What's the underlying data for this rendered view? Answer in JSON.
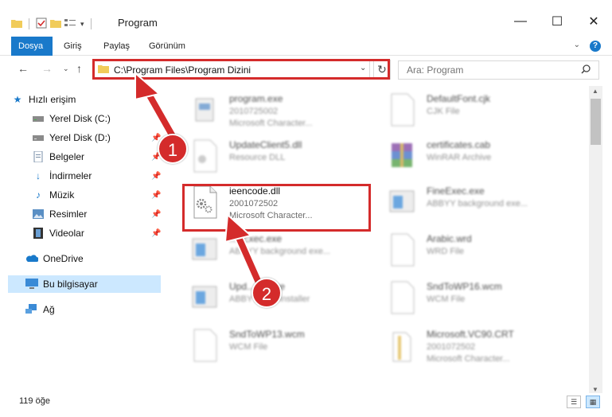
{
  "window": {
    "title": "Program",
    "minimize": "—",
    "maximize": "☐",
    "close": "✕"
  },
  "ribbon": {
    "tabs": [
      "Dosya",
      "Giriş",
      "Paylaş",
      "Görünüm"
    ],
    "help": "?"
  },
  "address": {
    "path": "C:\\Program Files\\Program Dizini",
    "search_placeholder": "Ara: Program"
  },
  "sidebar": {
    "items": [
      {
        "label": "Hızlı erişim",
        "icon": "star-icon"
      },
      {
        "label": "Yerel Disk (C:)",
        "icon": "drive-icon"
      },
      {
        "label": "Yerel Disk (D:)",
        "icon": "drive-icon"
      },
      {
        "label": "Belgeler",
        "icon": "documents-icon"
      },
      {
        "label": "İndirmeler",
        "icon": "download-icon"
      },
      {
        "label": "Müzik",
        "icon": "music-icon"
      },
      {
        "label": "Resimler",
        "icon": "pictures-icon"
      },
      {
        "label": "Videolar",
        "icon": "videos-icon"
      },
      {
        "label": "OneDrive",
        "icon": "cloud-icon"
      },
      {
        "label": "Bu bilgisayar",
        "icon": "computer-icon"
      },
      {
        "label": "Ağ",
        "icon": "network-icon"
      }
    ]
  },
  "files": [
    {
      "name": "program.exe",
      "line2": "2010725002",
      "line3": "Microsoft Character...",
      "icon": "exe-icon"
    },
    {
      "name": "DefaultFont.cjk",
      "line2": "CJK File",
      "line3": "",
      "icon": "blank-file-icon"
    },
    {
      "name": "UpdateClient5.dll",
      "line2": "Resource DLL",
      "line3": "",
      "icon": "dll-icon"
    },
    {
      "name": "certificates.cab",
      "line2": "WinRAR Archive",
      "line3": "",
      "icon": "archive-icon"
    },
    {
      "name": "ieencode.dll",
      "line2": "2001072502",
      "line3": "Microsoft Character...",
      "icon": "dll-gear-icon"
    },
    {
      "name": "FineExec.exe",
      "line2": "ABBYY background exe...",
      "line3": "",
      "icon": "window-exe-icon"
    },
    {
      "name": "...eExec.exe",
      "line2": "ABBYY background exe...",
      "line3": "",
      "icon": "window-exe-icon"
    },
    {
      "name": "Arabic.wrd",
      "line2": "WRD File",
      "line3": "",
      "icon": "blank-file-icon"
    },
    {
      "name": "Upd...ller.exe",
      "line2": "ABBYY ...ec installer",
      "line3": "",
      "icon": "window-exe-icon"
    },
    {
      "name": "SndToWP16.wcm",
      "line2": "WCM File",
      "line3": "",
      "icon": "blank-file-icon"
    },
    {
      "name": "SndToWP13.wcm",
      "line2": "WCM File",
      "line3": "",
      "icon": "blank-file-icon"
    },
    {
      "name": "Microsoft.VC90.CRT",
      "line2": "2001072502",
      "line3": "Microsoft Character...",
      "icon": "folder-icon"
    }
  ],
  "callouts": [
    "1",
    "2"
  ],
  "status": {
    "item_count": "119 öğe"
  },
  "colors": {
    "accent": "#1979ca",
    "highlight": "#d42b2b",
    "selected": "#cce8ff"
  }
}
